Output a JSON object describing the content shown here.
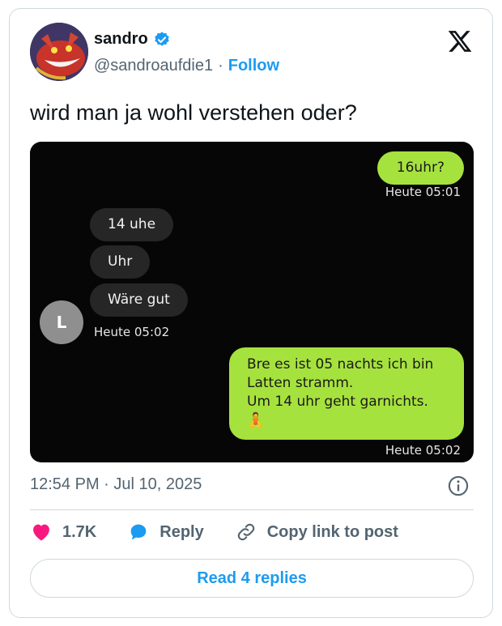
{
  "author": {
    "name": "sandro",
    "handle": "@sandroaufdie1",
    "separator": "·",
    "follow_label": "Follow"
  },
  "tweet": {
    "text": "wird man ja wohl verstehen oder?",
    "timestamp": "12:54 PM · Jul 10, 2025"
  },
  "chat": {
    "messages": [
      {
        "direction": "out",
        "text": "16uhr?"
      },
      {
        "direction": "out",
        "time": "Heute 05:01"
      },
      {
        "direction": "in",
        "text": "14 uhe"
      },
      {
        "direction": "in",
        "text": "Uhr"
      },
      {
        "direction": "in",
        "text": "Wäre gut"
      },
      {
        "direction": "in",
        "time": "Heute 05:02"
      },
      {
        "direction": "out",
        "lines": [
          "Bre es ist 05 nachts ich bin",
          "Latten stramm.",
          "Um 14 uhr geht garnichts."
        ],
        "emoji": "🧘"
      },
      {
        "direction": "out",
        "time": "Heute 05:02"
      }
    ],
    "contact_initial": "L"
  },
  "actions": {
    "likes": "1.7K",
    "reply_label": "Reply",
    "copy_label": "Copy link to post"
  },
  "read_replies_label": "Read 4 replies",
  "colors": {
    "accent": "#1d9bf0",
    "like": "#f91880",
    "outgoing_bubble": "#a6e23e",
    "incoming_bubble": "#262626"
  }
}
